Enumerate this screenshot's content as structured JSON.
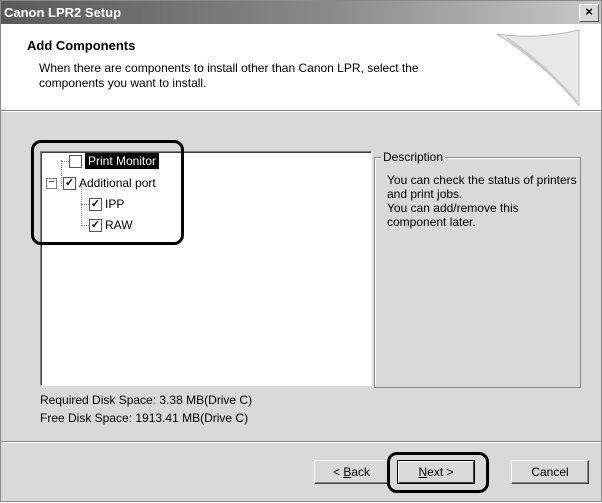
{
  "window": {
    "title": "Canon LPR2 Setup",
    "close_glyph": "×"
  },
  "header": {
    "title": "Add Components",
    "description": "When there are components to install other than Canon LPR, select the components you want to install."
  },
  "tree": {
    "items": [
      {
        "label": "Print Monitor",
        "checked": false,
        "selected": true
      },
      {
        "label": "Additional port",
        "checked": true,
        "expander": "−"
      },
      {
        "label": "IPP",
        "checked": true
      },
      {
        "label": "RAW",
        "checked": true
      }
    ],
    "check_glyph": "✓"
  },
  "description_group": {
    "legend": "Description",
    "text": "You can check the status of printers and print jobs.\nYou can add/remove this component later."
  },
  "disk": {
    "required": "Required Disk Space: 3.38 MB(Drive C)",
    "free": "Free Disk Space: 1913.41 MB(Drive C)"
  },
  "buttons": {
    "back_prefix": "< ",
    "back_mnemonic": "B",
    "back_rest": "ack",
    "next_mnemonic": "N",
    "next_rest": "ext >",
    "cancel": "Cancel"
  }
}
